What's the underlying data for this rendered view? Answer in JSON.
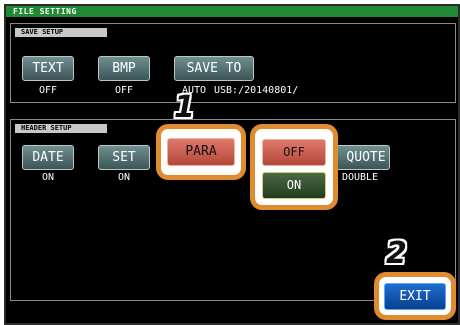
{
  "window": {
    "title": "FILE SETTING"
  },
  "save_setup": {
    "label": "SAVE SETUP",
    "buttons": [
      {
        "label": "TEXT",
        "value": "OFF"
      },
      {
        "label": "BMP",
        "value": "OFF"
      },
      {
        "label": "SAVE TO",
        "value": "AUTO",
        "path": "USB:/20140801/"
      }
    ]
  },
  "header_setup": {
    "label": "HEADER SETUP",
    "buttons": [
      {
        "label": "DATE",
        "value": "ON"
      },
      {
        "label": "SET",
        "value": "ON"
      },
      {
        "label": "PARA"
      },
      {
        "label": "QUOTE",
        "value": "DOUBLE"
      }
    ],
    "popup_options": [
      "OFF",
      "ON"
    ]
  },
  "exit_label": "EXIT",
  "callouts": [
    "1",
    "2"
  ],
  "colors": {
    "title_bar": "#1f8a33",
    "highlight_ring": "#e08b2e",
    "button": "#4f6d70",
    "exit": "#1560c4"
  }
}
